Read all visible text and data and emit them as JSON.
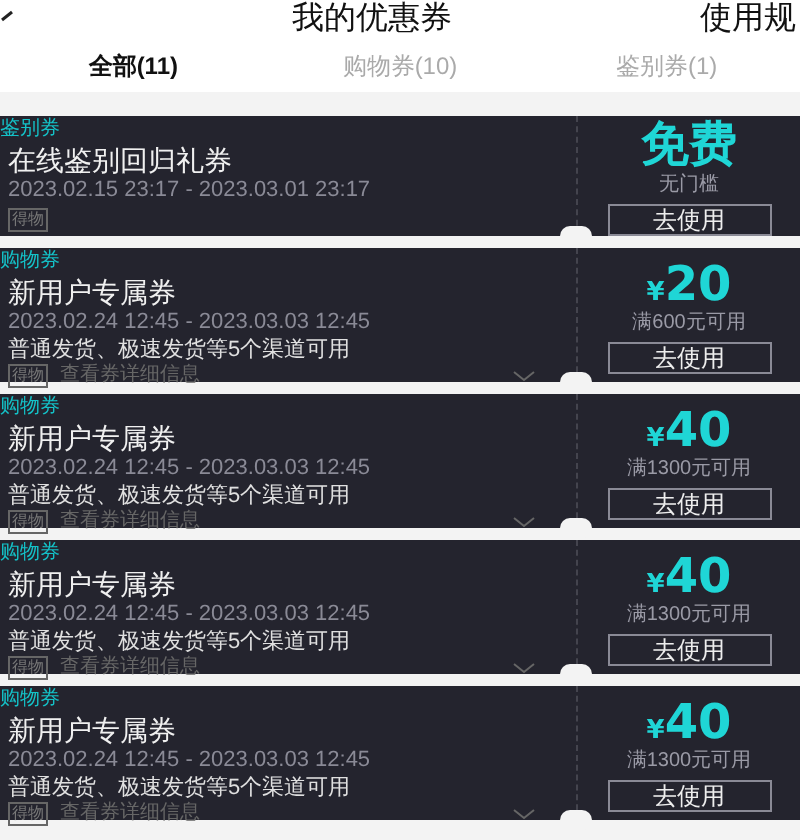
{
  "header": {
    "title": "我的优惠券",
    "rules_link": "使用规"
  },
  "tabs": [
    {
      "label": "全部(11)",
      "selected": true
    },
    {
      "label": "购物券(10)",
      "selected": false
    },
    {
      "label": "鉴别券(1)",
      "selected": false
    }
  ],
  "coupons": [
    {
      "tag": "鉴别券",
      "title": "在线鉴别回归礼券",
      "period": "2023.02.15 23:17 - 2023.03.01 23:17",
      "brand": "得物",
      "amount": "免费",
      "kind": "free",
      "condition": "无门槛",
      "action": "去使用"
    },
    {
      "tag": "购物券",
      "title": "新用户专属券",
      "period": "2023.02.24 12:45 - 2023.03.03 12:45",
      "channels": "普通发货、极速发货等5个渠道可用",
      "brand": "得物",
      "details": "查看券详细信息",
      "currency": "¥",
      "amount": "20",
      "kind": "money",
      "condition": "满600元可用",
      "action": "去使用"
    },
    {
      "tag": "购物券",
      "title": "新用户专属券",
      "period": "2023.02.24 12:45 - 2023.03.03 12:45",
      "channels": "普通发货、极速发货等5个渠道可用",
      "brand": "得物",
      "details": "查看券详细信息",
      "currency": "¥",
      "amount": "40",
      "kind": "money",
      "condition": "满1300元可用",
      "action": "去使用"
    },
    {
      "tag": "购物券",
      "title": "新用户专属券",
      "period": "2023.02.24 12:45 - 2023.03.03 12:45",
      "channels": "普通发货、极速发货等5个渠道可用",
      "brand": "得物",
      "details": "查看券详细信息",
      "currency": "¥",
      "amount": "40",
      "kind": "money",
      "condition": "满1300元可用",
      "action": "去使用"
    },
    {
      "tag": "购物券",
      "title": "新用户专属券",
      "period": "2023.02.24 12:45 - 2023.03.03 12:45",
      "channels": "普通发货、极速发货等5个渠道可用",
      "brand": "得物",
      "details": "查看券详细信息",
      "currency": "¥",
      "amount": "40",
      "kind": "money",
      "condition": "满1300元可用",
      "action": "去使用"
    }
  ]
}
